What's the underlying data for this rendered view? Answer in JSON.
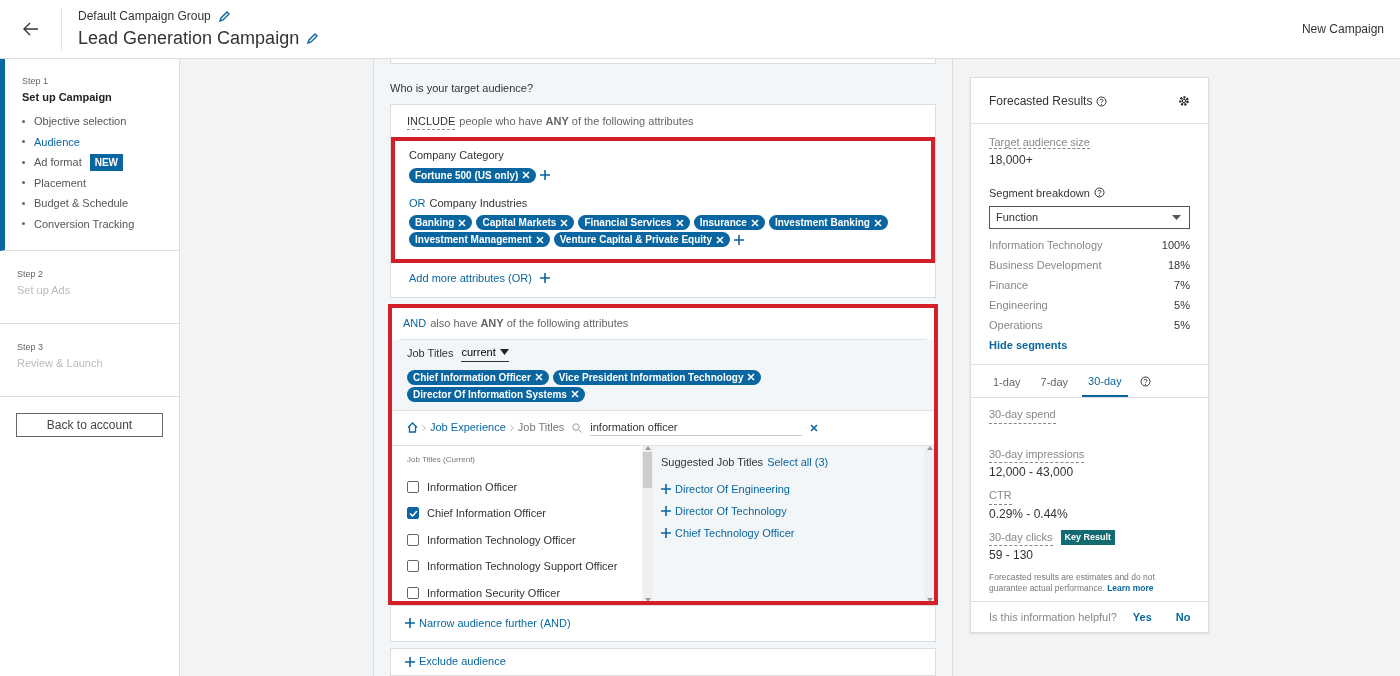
{
  "header": {
    "group_title": "Default Campaign Group",
    "campaign_title": "Lead Generation Campaign",
    "action": "New Campaign"
  },
  "sidebar": {
    "steps": [
      {
        "step": "Step 1",
        "title": "Set up Campaign",
        "active": true,
        "items": [
          {
            "label": "Objective selection",
            "selected": false
          },
          {
            "label": "Audience",
            "selected": true
          },
          {
            "label": "Ad format",
            "selected": false,
            "badge": "NEW"
          },
          {
            "label": "Placement",
            "selected": false
          },
          {
            "label": "Budget & Schedule",
            "selected": false
          },
          {
            "label": "Conversion Tracking",
            "selected": false
          }
        ]
      },
      {
        "step": "Step 2",
        "title": "Set up Ads",
        "active": false
      },
      {
        "step": "Step 3",
        "title": "Review & Launch",
        "active": false
      }
    ],
    "back_button": "Back to account"
  },
  "audience": {
    "question": "Who is your target audience?",
    "include": {
      "keyword": "INCLUDE",
      "text": "people who have **ANY** of the following attributes",
      "highlighted": true,
      "groups": [
        {
          "label": "Company Category",
          "tags": [
            "Fortune 500 (US only)"
          ]
        },
        {
          "connector": "OR",
          "label": "Company Industries",
          "tags": [
            "Banking",
            "Capital Markets",
            "Financial Services",
            "Insurance",
            "Investment Banking",
            "Investment Management",
            "Venture Capital & Private Equity"
          ]
        }
      ],
      "add_more": "Add more attributes (OR)"
    },
    "narrow": {
      "connector": "AND",
      "text": "also have **ANY** of the following attributes",
      "highlighted": true,
      "label": "Job Titles",
      "filter": "current",
      "tags": [
        "Chief Information Officer",
        "Vice President Information Technology",
        "Director Of Information Systems"
      ],
      "breadcrumb": [
        "Job Experience",
        "Job Titles"
      ],
      "search": "information officer",
      "list_heading": "Job Titles (Current)",
      "options": [
        {
          "label": "Information Officer",
          "checked": false
        },
        {
          "label": "Chief Information Officer",
          "checked": true
        },
        {
          "label": "Information Technology Officer",
          "checked": false
        },
        {
          "label": "Information Technology Support Officer",
          "checked": false
        },
        {
          "label": "Information Security Officer",
          "checked": false
        }
      ],
      "suggested_heading": "Suggested Job Titles",
      "select_all": "Select all (3)",
      "suggestions": [
        "Director Of Engineering",
        "Director Of Technology",
        "Chief Technology Officer"
      ]
    },
    "narrow_further": "Narrow audience further (AND)",
    "exclude": "Exclude audience"
  },
  "forecast": {
    "title": "Forecasted Results",
    "audience_label": "Target audience size",
    "audience_value": "18,000+",
    "segment_label": "Segment breakdown",
    "segment_select": "Function",
    "segments": [
      {
        "name": "Information Technology",
        "value": "100%"
      },
      {
        "name": "Business Development",
        "value": "18%"
      },
      {
        "name": "Finance",
        "value": "7%"
      },
      {
        "name": "Engineering",
        "value": "5%"
      },
      {
        "name": "Operations",
        "value": "5%"
      }
    ],
    "hide_segments": "Hide segments",
    "tabs": [
      {
        "label": "1-day",
        "selected": false
      },
      {
        "label": "7-day",
        "selected": false
      },
      {
        "label": "30-day",
        "selected": true
      }
    ],
    "metrics": [
      {
        "label": "30-day spend"
      },
      {
        "label": "30-day impressions",
        "value": "12,000 - 43,000"
      },
      {
        "label": "CTR",
        "value": "0.29% - 0.44%"
      },
      {
        "label": "30-day clicks",
        "value": "59 - 130",
        "badge": "Key Result"
      }
    ],
    "disclaimer": "Forecasted results are estimates and do not guarantee actual performance.",
    "learn_more": "Learn more",
    "feedback": "Is this information helpful?",
    "yes": "Yes",
    "no": "No"
  }
}
